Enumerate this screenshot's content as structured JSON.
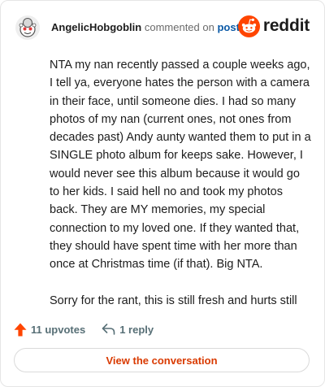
{
  "comment": {
    "username": "AngelicHobgoblin",
    "action_text": "commented on",
    "post_link": "post",
    "paragraphs": [
      "NTA my nan recently passed a couple weeks ago, I tell ya, everyone hates the person with a camera in their face, until someone dies. I had so many photos of my nan (current ones, not ones from decades past) Andy aunty wanted them to put in a SINGLE photo album for keeps sake. However, I would never see this album because it would go to her kids. I said hell no and took my photos back. They are MY memories, my special connection to my loved one. If they wanted that, they should have spent time with her more than once at Christmas time (if that). Big NTA.",
      "Sorry for the rant, this is still fresh and hurts still"
    ]
  },
  "brand": {
    "wordmark": "reddit",
    "icon": "reddit-snoo-icon",
    "color": "#ff4500"
  },
  "actions": {
    "upvotes_label": "11 upvotes",
    "upvote_icon": "upvote-arrow-icon",
    "upvote_color": "#ff4500",
    "reply_label": "1 reply",
    "reply_icon": "reply-arrow-icon"
  },
  "footer": {
    "view_button_label": "View the conversation",
    "button_color": "#d93a00"
  },
  "avatar": {
    "icon": "snoo-avatar-icon"
  }
}
